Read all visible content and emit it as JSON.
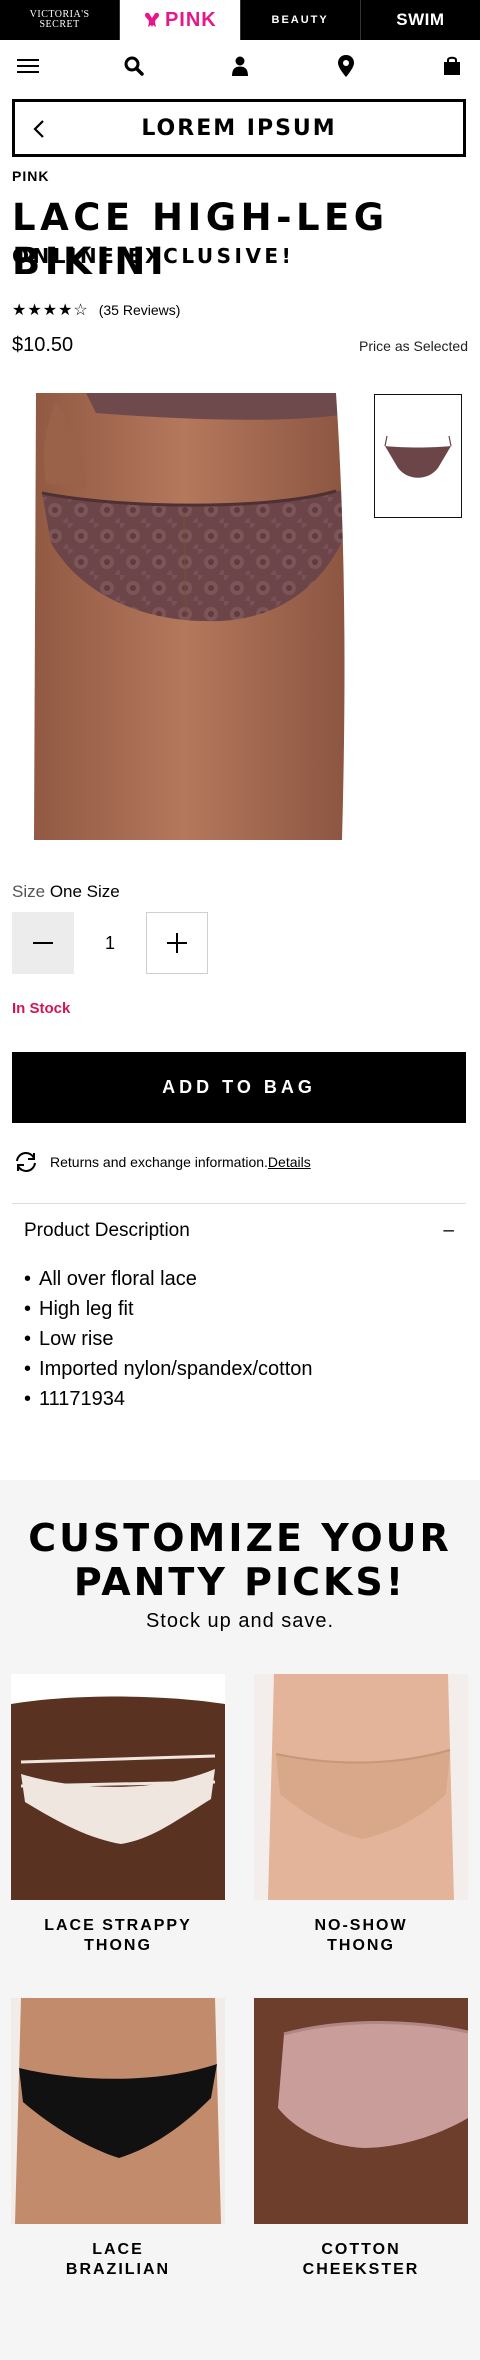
{
  "brandbar": {
    "vs_line1": "VICTORIA'S",
    "vs_line2": "SECRET",
    "pink": "PINK",
    "beauty": "BEAUTY",
    "swim": "SWIM"
  },
  "nav_icons": [
    "menu-icon",
    "search-icon",
    "account-icon",
    "location-icon",
    "bag-icon"
  ],
  "title_bar": {
    "title": "LOREM IPSUM"
  },
  "product": {
    "brand": "PINK",
    "name": "LACE HIGH-LEG BIKINI",
    "tag": "ONLINE EXCLUSIVE!",
    "rating_stars": 4.5,
    "stars_glyphs": "★★★★☆",
    "reviews": "(35 Reviews)",
    "price": "$10.50",
    "price_note": "Price as Selected",
    "size_label": "Size",
    "size_value": "One Size",
    "quantity": "1",
    "stock": "In Stock",
    "add_to_bag": "ADD TO BAG",
    "returns_text": "Returns and exchange information.",
    "returns_link": "Details"
  },
  "description": {
    "heading": "Product Description",
    "toggle": "–",
    "bullets": [
      "All over floral lace",
      "High leg fit",
      "Low rise",
      "Imported nylon/spandex/cotton",
      "11171934"
    ]
  },
  "customize": {
    "heading_line1": "CUSTOMIZE YOUR",
    "heading_line2": "PANTY PICKS!",
    "subheading": "Stock up and save.",
    "cards": [
      {
        "line1": "LACE STRAPPY",
        "line2": "THONG"
      },
      {
        "line1": "NO-SHOW",
        "line2": "THONG"
      },
      {
        "line1": "LACE",
        "line2": "BRAZILIAN"
      },
      {
        "line1": "COTTON",
        "line2": "CHEEKSTER"
      }
    ]
  },
  "colors": {
    "brand_pink": "#e6178a",
    "stock_red": "#d4145a",
    "product_mauve": "#6b4548",
    "skin": "#b07158"
  }
}
